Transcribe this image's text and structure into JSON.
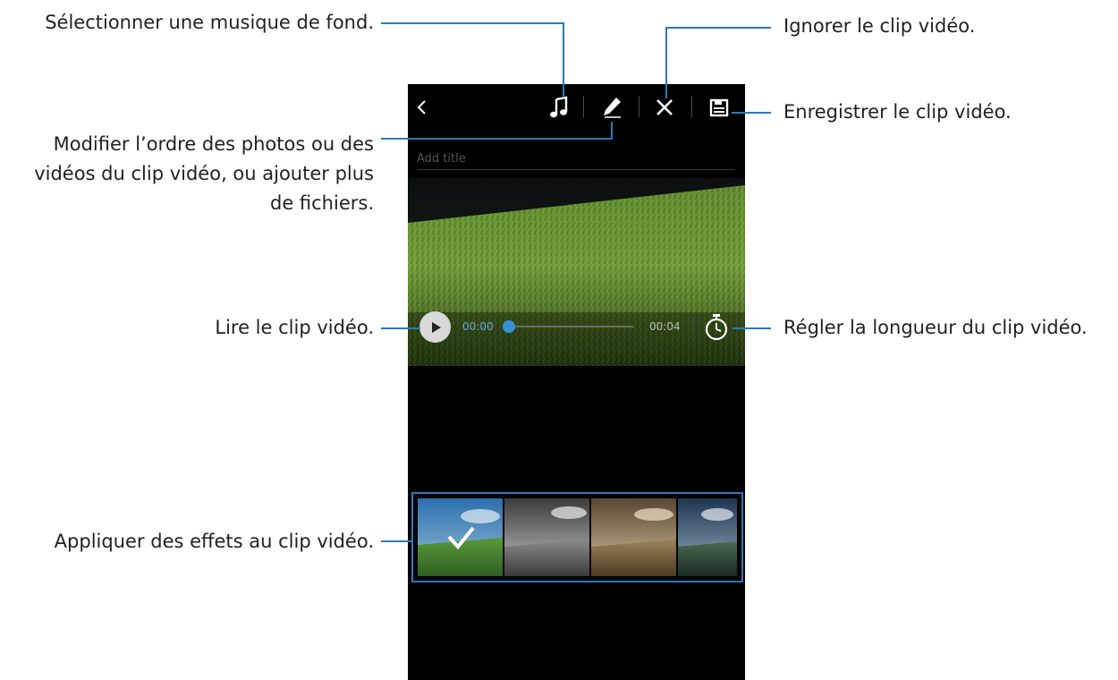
{
  "callouts": {
    "music": "Sélectionner une musique de fond.",
    "edit_line1": "Modifier l’ordre des photos ou des",
    "edit_line2": "vidéos du clip vidéo, ou ajouter plus",
    "edit_line3": "de fichiers.",
    "play": "Lire le clip vidéo.",
    "effects": "Appliquer des effets au clip vidéo.",
    "discard": "Ignorer le clip vidéo.",
    "save": "Enregistrer le clip vidéo.",
    "length": "Régler la longueur du clip vidéo."
  },
  "toolbar": {
    "back_icon": "chevron-left-icon",
    "music_icon": "music-note-icon",
    "edit_icon": "pencil-icon",
    "discard_icon": "close-icon",
    "save_icon": "save-icon"
  },
  "title_field": {
    "placeholder": "Add title",
    "value": ""
  },
  "player": {
    "current_time": "00:00",
    "total_time": "00:04",
    "progress": 0,
    "play_icon": "play-icon",
    "length_icon": "stopwatch-icon"
  },
  "effects": {
    "items": [
      {
        "name": "original",
        "selected": true
      },
      {
        "name": "black-and-white",
        "selected": false
      },
      {
        "name": "sepia",
        "selected": false
      },
      {
        "name": "vintage",
        "selected": false
      }
    ]
  },
  "colors": {
    "accent_line": "#2a7ab8",
    "progress": "#3a8fd9",
    "background": "#000000"
  }
}
